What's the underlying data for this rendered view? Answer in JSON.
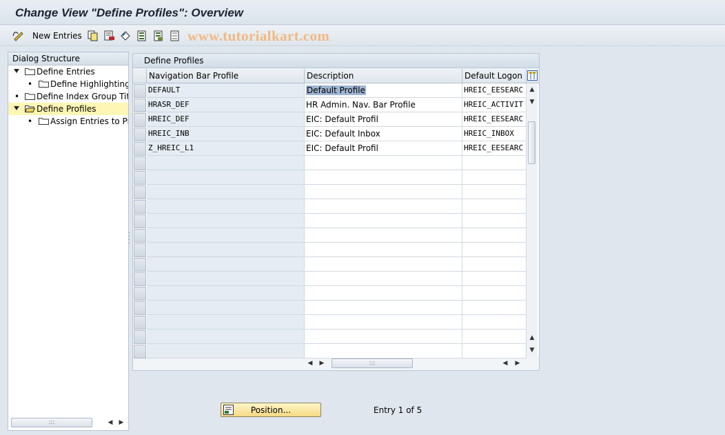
{
  "window": {
    "title": "Change View \"Define Profiles\": Overview"
  },
  "toolbar": {
    "new_entries_label": "New Entries",
    "watermark": "www.tutorialkart.com",
    "icons": [
      "edit-glasses-icon",
      "copy-icon",
      "delete-icon",
      "undo-icon",
      "select-all-icon",
      "select-block-icon",
      "deselect-all-icon"
    ]
  },
  "dialog": {
    "title": "Dialog Structure",
    "items": [
      {
        "label": "Define Entries",
        "level": 0,
        "expanded": true,
        "selected": false
      },
      {
        "label": "Define Highlighting",
        "level": 1,
        "expanded": false,
        "selected": false
      },
      {
        "label": "Define Index Group Title",
        "level": 0,
        "expanded": false,
        "selected": false
      },
      {
        "label": "Define Profiles",
        "level": 0,
        "expanded": true,
        "selected": true
      },
      {
        "label": "Assign Entries to Pro",
        "level": 1,
        "expanded": false,
        "selected": false
      }
    ]
  },
  "table": {
    "title": "Define Profiles",
    "columns": [
      "Navigation Bar Profile",
      "Description",
      "Default Logon E"
    ],
    "rows": [
      [
        "DEFAULT",
        "Default Profile",
        "HREIC_EESEARC"
      ],
      [
        "HRASR_DEF",
        "HR Admin. Nav. Bar Profile",
        "HREIC_ACTIVIT"
      ],
      [
        "HREIC_DEF",
        "EIC: Default Profil",
        "HREIC_EESEARC"
      ],
      [
        "HREIC_INB",
        "EIC: Default Inbox",
        "HREIC_INBOX"
      ],
      [
        "Z_HREIC_L1",
        "EIC: Default Profil",
        "HREIC_EESEARC"
      ]
    ],
    "selected_cell": {
      "row": 0,
      "col": 1
    }
  },
  "footer": {
    "position_button_label": "Position...",
    "entry_info": "Entry 1 of 5"
  },
  "colors": {
    "selected_tree_row": "#fdf6b4",
    "key_column": "#e5ecf3",
    "highlight": "#9fb6d2",
    "button": "#f5d983"
  }
}
